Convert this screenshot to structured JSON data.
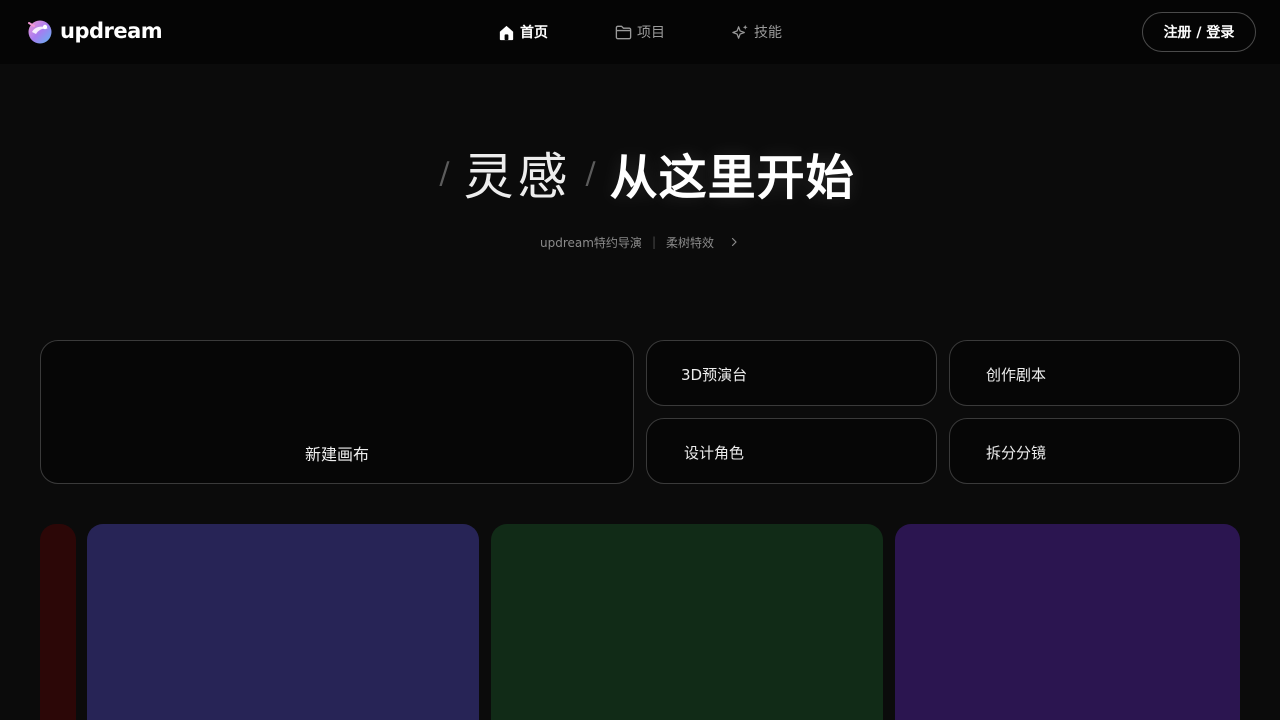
{
  "header": {
    "logo_text": "updream",
    "nav": [
      {
        "label": "首页",
        "icon": "home-icon",
        "active": true
      },
      {
        "label": "项目",
        "icon": "folder-icon",
        "active": false
      },
      {
        "label": "技能",
        "icon": "sparkle-icon",
        "active": false
      }
    ],
    "login_label": "注册 / 登录"
  },
  "hero": {
    "light": "灵感",
    "bold": "从这里开始",
    "slash": "/"
  },
  "sub_links": {
    "first": "updream特约导演",
    "separator": "|",
    "second": "柔树特效"
  },
  "actions": {
    "new_canvas": "新建画布",
    "preview_3d": "3D预演台",
    "write_script": "创作剧本",
    "design_character": "设计角色",
    "split_storyboard": "拆分分镜"
  },
  "gallery": {
    "tile_colors": [
      "#2c0707",
      "#272456",
      "#112b17",
      "#2b1550"
    ]
  },
  "colors": {
    "background": "#0b0b0b",
    "header_bg": "#050505",
    "card_border": "#3a3a3a"
  }
}
